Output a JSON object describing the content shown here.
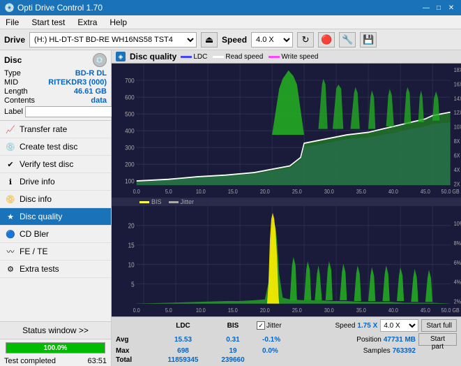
{
  "titleBar": {
    "title": "Opti Drive Control 1.70",
    "minBtn": "—",
    "maxBtn": "□",
    "closeBtn": "✕"
  },
  "menuBar": {
    "items": [
      "File",
      "Start test",
      "Extra",
      "Help"
    ]
  },
  "driveBar": {
    "driveLabel": "Drive",
    "driveValue": "(H:)  HL-DT-ST BD-RE  WH16NS58 TST4",
    "speedLabel": "Speed",
    "speedValue": "4.0 X"
  },
  "disc": {
    "title": "Disc",
    "typeLabel": "Type",
    "typeValue": "BD-R DL",
    "midLabel": "MID",
    "midValue": "RITEKDR3 (000)",
    "lengthLabel": "Length",
    "lengthValue": "46.61 GB",
    "contentsLabel": "Contents",
    "contentsValue": "data",
    "labelLabel": "Label"
  },
  "nav": [
    {
      "id": "transfer-rate",
      "label": "Transfer rate",
      "icon": "📈"
    },
    {
      "id": "create-test-disc",
      "label": "Create test disc",
      "icon": "💿"
    },
    {
      "id": "verify-test-disc",
      "label": "Verify test disc",
      "icon": "✔"
    },
    {
      "id": "drive-info",
      "label": "Drive info",
      "icon": "ℹ"
    },
    {
      "id": "disc-info",
      "label": "Disc info",
      "icon": "📀"
    },
    {
      "id": "disc-quality",
      "label": "Disc quality",
      "icon": "★",
      "active": true
    },
    {
      "id": "cd-bler",
      "label": "CD Bler",
      "icon": "🔵"
    },
    {
      "id": "fe-te",
      "label": "FE / TE",
      "icon": "〰"
    },
    {
      "id": "extra-tests",
      "label": "Extra tests",
      "icon": "⚙"
    }
  ],
  "statusWindow": {
    "label": "Status window >>",
    "progressPct": 100,
    "progressText": "100.0%",
    "statusText": "Test completed",
    "time": "63:51"
  },
  "discQuality": {
    "title": "Disc quality",
    "legend": [
      {
        "label": "LDC",
        "color": "#4444ff"
      },
      {
        "label": "Read speed",
        "color": "#ffffff"
      },
      {
        "label": "Write speed",
        "color": "#ff44ff"
      }
    ],
    "legend2": [
      {
        "label": "BIS",
        "color": "#ffff00"
      },
      {
        "label": "Jitter",
        "color": "#ffffff"
      }
    ]
  },
  "stats": {
    "colHeaders": [
      "LDC",
      "BIS",
      "",
      "Jitter",
      "Speed",
      ""
    ],
    "avgLabel": "Avg",
    "avgLDC": "15.53",
    "avgBIS": "0.31",
    "avgJitter": "-0.1%",
    "maxLabel": "Max",
    "maxLDC": "698",
    "maxBIS": "19",
    "maxJitter": "0.0%",
    "totalLabel": "Total",
    "totalLDC": "11859345",
    "totalBIS": "239660",
    "speedLabel": "Speed",
    "speedValue": "1.75 X",
    "speedDropdown": "4.0 X",
    "positionLabel": "Position",
    "positionValue": "47731 MB",
    "samplesLabel": "Samples",
    "samplesValue": "763392",
    "startFullBtn": "Start full",
    "startPartBtn": "Start part",
    "jitterLabel": "Jitter",
    "jitterChecked": true
  },
  "chartTop": {
    "yMax": 700,
    "yMin": 0,
    "xMax": 50,
    "yRightLabels": [
      "18X",
      "16X",
      "14X",
      "12X",
      "10X",
      "8X",
      "6X",
      "4X",
      "2X"
    ],
    "yLeftLabels": [
      "700",
      "600",
      "500",
      "400",
      "300",
      "200",
      "100"
    ],
    "xLabels": [
      "0.0",
      "5.0",
      "10.0",
      "15.0",
      "20.0",
      "25.0",
      "30.0",
      "35.0",
      "40.0",
      "45.0",
      "50.0 GB"
    ]
  },
  "chartBottom": {
    "yMax": 20,
    "yMin": 0,
    "xMax": 50,
    "yRightLabels": [
      "10%",
      "8%",
      "6%",
      "4%",
      "2%"
    ],
    "yLeftLabels": [
      "20",
      "15",
      "10",
      "5"
    ],
    "xLabels": [
      "0.0",
      "5.0",
      "10.0",
      "15.0",
      "20.0",
      "25.0",
      "30.0",
      "35.0",
      "40.0",
      "45.0",
      "50.0 GB"
    ]
  }
}
